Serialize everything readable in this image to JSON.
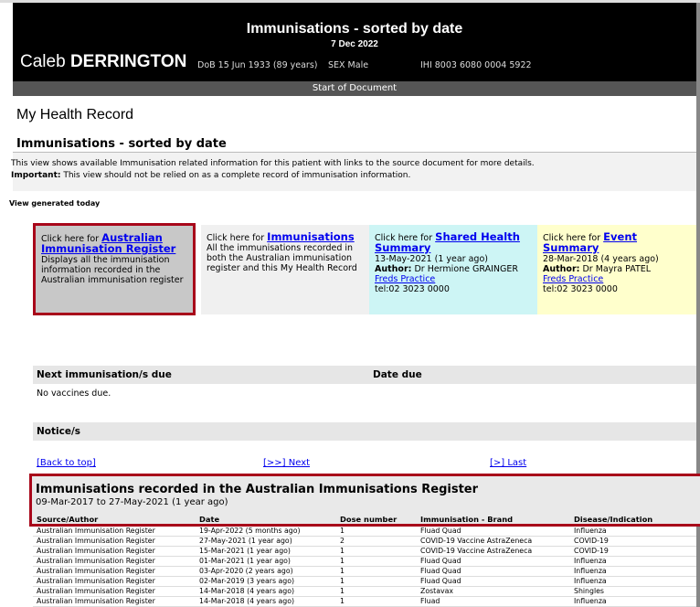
{
  "header": {
    "title": "Immunisations - sorted by date",
    "date": "7 Dec 2022",
    "patient_first": "Caleb",
    "patient_last": "DERRINGTON",
    "dob": "DoB 15 Jun 1933 (89 years)",
    "sex": "SEX Male",
    "ihi": "IHI 8003 6080 0004 5922"
  },
  "start_bar": "Start of Document",
  "page_title": "My Health Record",
  "section_title": "Immunisations - sorted by date",
  "info": {
    "line1": "This view shows available Immunisation related information for this patient with links to the source document for more details.",
    "important_label": "Important:",
    "line2": " This view should not be relied on as a complete record of immunisation information."
  },
  "view_generated": "View generated today",
  "tiles": {
    "air": {
      "prefix": "Click here for ",
      "link": "Australian Immunisation Register",
      "desc": "Displays all the immunisation information recorded in the Australian immunisation register"
    },
    "imm": {
      "prefix": "Click here for ",
      "link": "Immunisations",
      "desc": "All the immunisations recorded in both the Australian immunisation register and this My Health Record"
    },
    "shs": {
      "prefix": "Click here for ",
      "link": "Shared Health Summary",
      "date": "13-May-2021 (1 year ago)",
      "author_label": "Author:",
      "author": " Dr Hermione GRAINGER",
      "org": "Freds Practice",
      "tel": "tel:02 3023 0000"
    },
    "evs": {
      "prefix": "Click here for ",
      "link": "Event Summary",
      "date": "28-Mar-2018 (4 years ago)",
      "author_label": "Author:",
      "author": " Dr Mayra PATEL",
      "org": "Freds Practice",
      "tel": "tel:02 3023 0000"
    }
  },
  "next_due": {
    "col1": "Next immunisation/s due",
    "col2": "Date due",
    "empty": "No vaccines due."
  },
  "notices": {
    "title": "Notice/s"
  },
  "nav": {
    "top": "[Back to top]",
    "next": "[>>] Next",
    "last": "[>] Last"
  },
  "air_section": {
    "title": "Immunisations recorded in the Australian Immunisations Register",
    "range": "09-Mar-2017 to 27-May-2021 (1 year ago)",
    "columns": [
      "Source/Author",
      "Date",
      "Dose number",
      "Immunisation - Brand",
      "Disease/Indication"
    ],
    "rows": [
      [
        "Australian Immunisation Register",
        "19-Apr-2022 (5 months ago)",
        "1",
        "Fluad Quad",
        "Influenza"
      ],
      [
        "Australian Immunisation Register",
        "27-May-2021 (1 year ago)",
        "2",
        "COVID-19 Vaccine AstraZeneca",
        "COVID-19"
      ],
      [
        "Australian Immunisation Register",
        "15-Mar-2021 (1 year ago)",
        "1",
        "COVID-19 Vaccine AstraZeneca",
        "COVID-19"
      ],
      [
        "Australian Immunisation Register",
        "01-Mar-2021 (1 year ago)",
        "1",
        "Fluad Quad",
        "Influenza"
      ],
      [
        "Australian Immunisation Register",
        "03-Apr-2020 (2 years ago)",
        "1",
        "Fluad Quad",
        "Influenza"
      ],
      [
        "Australian Immunisation Register",
        "02-Mar-2019 (3 years ago)",
        "1",
        "Fluad Quad",
        "Influenza"
      ],
      [
        "Australian Immunisation Register",
        "14-Mar-2018 (4 years ago)",
        "1",
        "Zostavax",
        "Shingles"
      ],
      [
        "Australian Immunisation Register",
        "14-Mar-2018 (4 years ago)",
        "1",
        "Fluad",
        "Influenza"
      ]
    ]
  }
}
